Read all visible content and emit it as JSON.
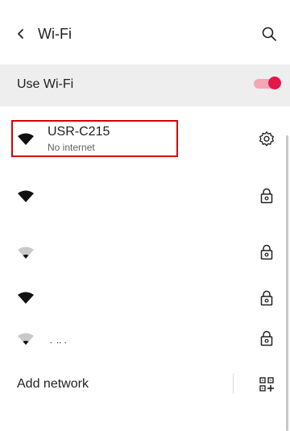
{
  "header": {
    "title": "Wi-Fi",
    "back_icon": "chevron-left-icon",
    "search_icon": "search-icon"
  },
  "use_wifi": {
    "label": "Use Wi-Fi",
    "enabled": true,
    "accent_color": "#e4174a"
  },
  "connected_network": {
    "name": "USR-C215",
    "status": "No internet",
    "highlight_color": "#d80000",
    "settings_icon": "gear-icon"
  },
  "other_networks": [
    {
      "signal": "full",
      "secured": true
    },
    {
      "signal": "weak",
      "secured": true
    },
    {
      "signal": "full",
      "secured": true
    },
    {
      "signal": "weak",
      "secured": true,
      "partial_text": "OU"
    }
  ],
  "footer": {
    "add_network_label": "Add network",
    "qr_icon": "qr-code-scan-icon"
  }
}
